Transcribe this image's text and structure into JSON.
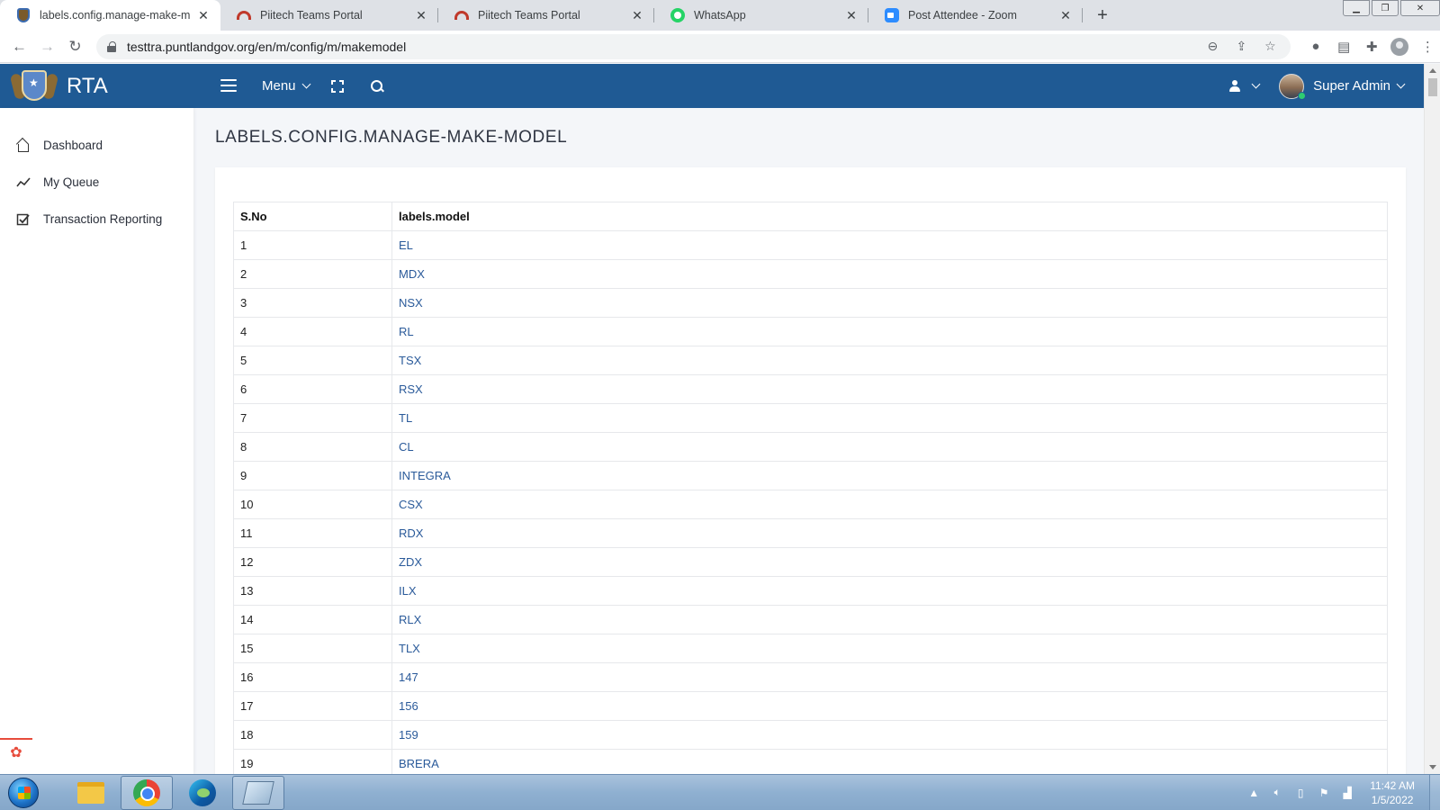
{
  "browser": {
    "tabs": [
      {
        "title": "labels.config.manage-make-mod",
        "favicon": "crest-icon",
        "active": true
      },
      {
        "title": "Piitech Teams Portal",
        "favicon": "teams-portal-icon",
        "active": false
      },
      {
        "title": "Piitech Teams Portal",
        "favicon": "teams-portal-icon",
        "active": false
      },
      {
        "title": "WhatsApp",
        "favicon": "whatsapp-icon",
        "active": false
      },
      {
        "title": "Post Attendee - Zoom",
        "favicon": "zoom-icon",
        "active": false
      }
    ],
    "url": "testtra.puntlandgov.org/en/m/config/m/makemodel"
  },
  "header": {
    "brand": "RTA",
    "menu_label": "Menu",
    "user_name": "Super Admin"
  },
  "sidebar": {
    "items": [
      {
        "label": "Dashboard",
        "icon": "home-icon"
      },
      {
        "label": "My Queue",
        "icon": "trend-icon"
      },
      {
        "label": "Transaction Reporting",
        "icon": "checkbox-icon"
      }
    ]
  },
  "main": {
    "title": "LABELS.CONFIG.MANAGE-MAKE-MODEL",
    "table": {
      "columns": [
        "S.No",
        "labels.model"
      ],
      "rows": [
        {
          "sno": "1",
          "model": "EL"
        },
        {
          "sno": "2",
          "model": "MDX"
        },
        {
          "sno": "3",
          "model": "NSX"
        },
        {
          "sno": "4",
          "model": "RL"
        },
        {
          "sno": "5",
          "model": "TSX"
        },
        {
          "sno": "6",
          "model": "RSX"
        },
        {
          "sno": "7",
          "model": "TL"
        },
        {
          "sno": "8",
          "model": "CL"
        },
        {
          "sno": "9",
          "model": "INTEGRA"
        },
        {
          "sno": "10",
          "model": "CSX"
        },
        {
          "sno": "11",
          "model": "RDX"
        },
        {
          "sno": "12",
          "model": "ZDX"
        },
        {
          "sno": "13",
          "model": "ILX"
        },
        {
          "sno": "14",
          "model": "RLX"
        },
        {
          "sno": "15",
          "model": "TLX"
        },
        {
          "sno": "16",
          "model": "147"
        },
        {
          "sno": "17",
          "model": "156"
        },
        {
          "sno": "18",
          "model": "159"
        },
        {
          "sno": "19",
          "model": "BRERA"
        }
      ]
    }
  },
  "taskbar": {
    "time": "11:42 AM",
    "date": "1/5/2022"
  },
  "colors": {
    "header_bg": "#1f5a94",
    "link": "#2a5a9a",
    "page_bg": "#f4f6f9"
  }
}
